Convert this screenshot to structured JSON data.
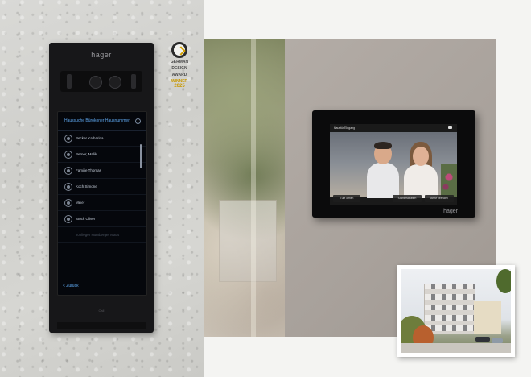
{
  "door_station": {
    "brand": "hager",
    "list_title": "Haussuche Bürokoner Hausnummer",
    "entries": [
      "Becker Katharina",
      "Berner, Malik",
      "Familie Thomas",
      "Koch Simone",
      "Meier",
      "Stock Oliver",
      "Tonlieger Homberger Maus"
    ],
    "back_label": "< Zurück",
    "footer_label": "Call"
  },
  "award": {
    "lines": [
      "GERMAN",
      "DESIGN",
      "AWARD",
      "WINNER"
    ],
    "year": "2025"
  },
  "indoor_monitor": {
    "brand": "hager",
    "header_label": "Haustür/Eingang",
    "buttons": [
      "Türe öffnen",
      "Stummschalten",
      "Anruf beenden"
    ]
  },
  "colors": {
    "accent_blue": "#5fa8f0",
    "award_gold": "#c89800",
    "panel_black": "#171719"
  }
}
